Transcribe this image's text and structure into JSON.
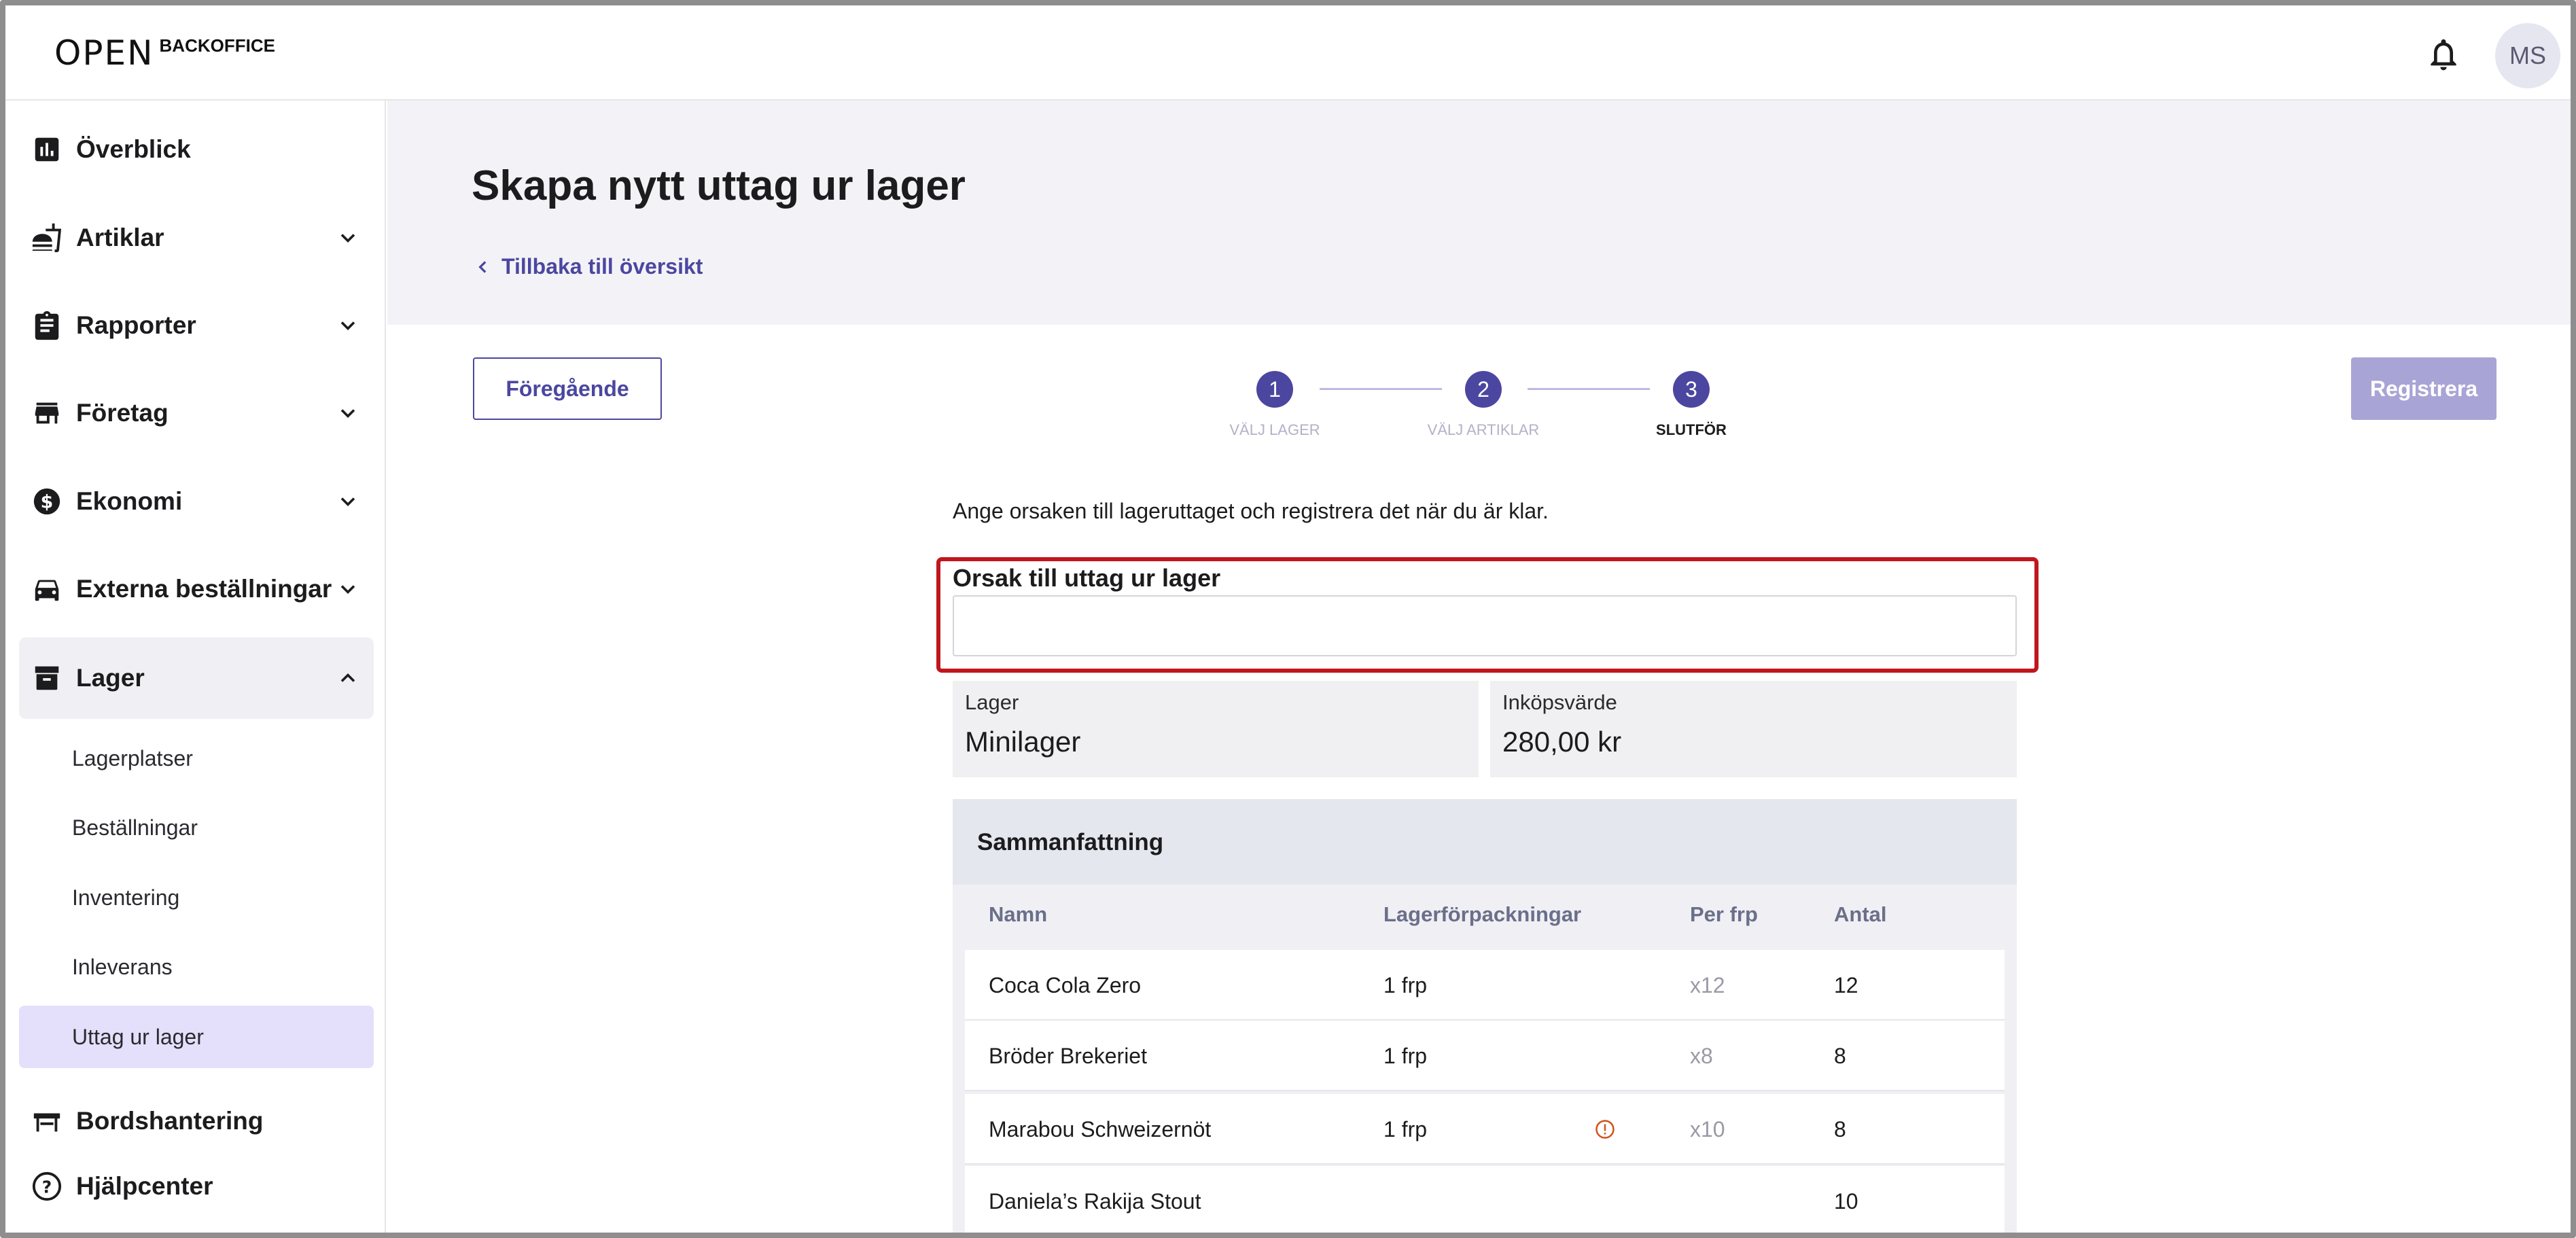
{
  "app": {
    "logo_mark": "OPEN",
    "logo_text": "BACKOFFICE",
    "avatar_initials": "MS"
  },
  "sidebar": {
    "items": [
      {
        "label": "Överblick",
        "icon": "chart-icon",
        "expandable": false
      },
      {
        "label": "Artiklar",
        "icon": "food-icon",
        "expandable": true
      },
      {
        "label": "Rapporter",
        "icon": "clipboard-icon",
        "expandable": true
      },
      {
        "label": "Företag",
        "icon": "store-icon",
        "expandable": true
      },
      {
        "label": "Ekonomi",
        "icon": "dollar-icon",
        "expandable": true
      },
      {
        "label": "Externa beställningar",
        "icon": "car-icon",
        "expandable": true
      },
      {
        "label": "Lager",
        "icon": "archive-icon",
        "expandable": true,
        "expanded": true
      }
    ],
    "lager_subitems": [
      {
        "label": "Lagerplatser"
      },
      {
        "label": "Beställningar"
      },
      {
        "label": "Inventering"
      },
      {
        "label": "Inleverans"
      },
      {
        "label": "Uttag ur lager",
        "selected": true
      }
    ],
    "bottom_items": [
      {
        "label": "Bordshantering",
        "icon": "table-icon"
      },
      {
        "label": "Hjälpcenter",
        "icon": "help-icon"
      }
    ]
  },
  "page": {
    "title": "Skapa nytt uttag ur lager",
    "back_link": "Tillbaka till översikt"
  },
  "actions": {
    "previous_label": "Föregående",
    "register_label": "Registrera"
  },
  "stepper": {
    "steps": [
      {
        "number": "1",
        "label": "VÄLJ LAGER"
      },
      {
        "number": "2",
        "label": "VÄLJ ARTIKLAR"
      },
      {
        "number": "3",
        "label": "SLUTFÖR",
        "current": true
      }
    ]
  },
  "form": {
    "intro": "Ange orsaken till lageruttaget och registrera det när du är klar.",
    "reason_label": "Orsak till uttag ur lager",
    "reason_value": "",
    "reason_placeholder": ""
  },
  "info": {
    "lager_label": "Lager",
    "lager_value": "Minilager",
    "inkop_label": "Inköpsvärde",
    "inkop_value": "280,00 kr"
  },
  "summary": {
    "title": "Sammanfattning",
    "columns": [
      "Namn",
      "Lagerförpackningar",
      "Per frp",
      "Antal"
    ],
    "rows": [
      {
        "name": "Coca Cola Zero",
        "packages": "1 frp",
        "per": "x12",
        "qty": "12",
        "warning": false
      },
      {
        "name": "Bröder Brekeriet",
        "packages": "1 frp",
        "per": "x8",
        "qty": "8",
        "warning": false
      },
      {
        "name": "Marabou Schweizernöt",
        "packages": "1 frp",
        "per": "x10",
        "qty": "8",
        "warning": true
      },
      {
        "name": "Daniela’s Rakija Stout",
        "packages": "",
        "per": "",
        "qty": "10",
        "warning": false
      }
    ]
  },
  "colors": {
    "accent": "#4b47a0",
    "register_disabled": "#a9a4d6",
    "highlight": "#c0161c",
    "selected_bg": "#e4e0fb",
    "warning": "#d0541a"
  }
}
